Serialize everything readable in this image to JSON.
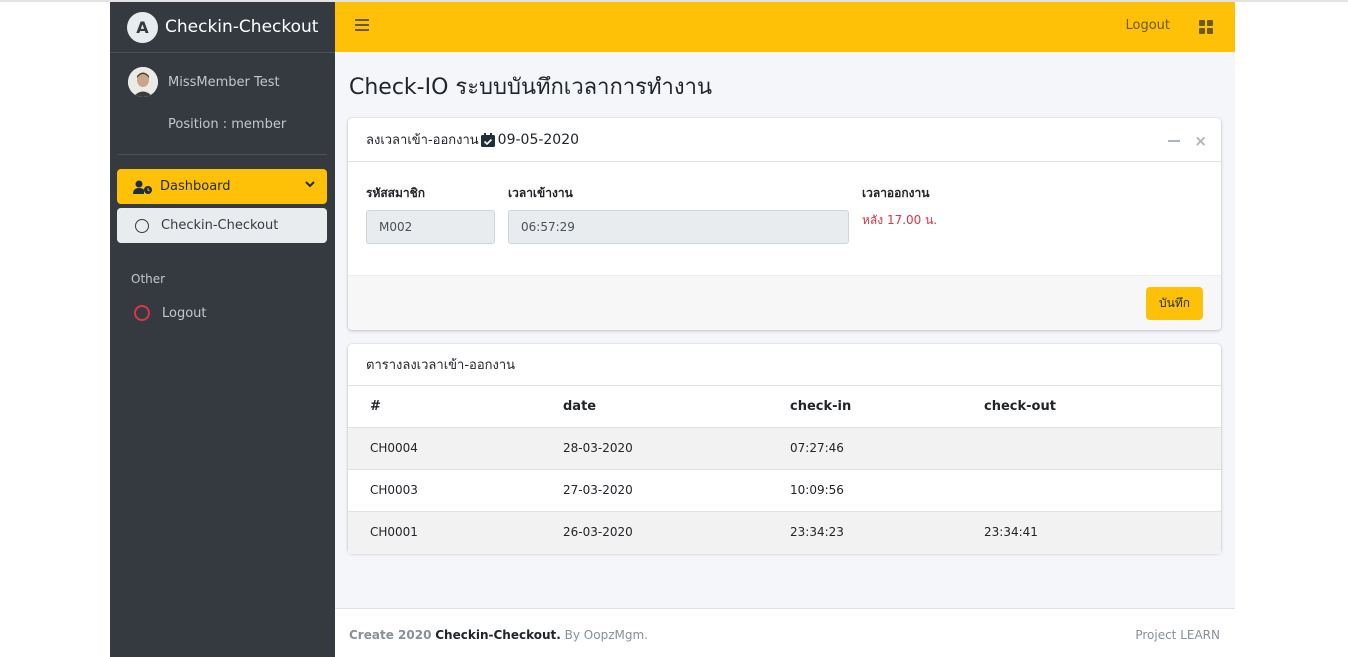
{
  "brand": {
    "name": "Checkin-Checkout",
    "logo_letter": "A"
  },
  "user": {
    "name": "MissMember Test",
    "position": "Position : member"
  },
  "sidebar": {
    "dashboard_label": "Dashboard",
    "submenu_label": "Checkin-Checkout",
    "other_header": "Other",
    "logout_label": "Logout"
  },
  "navbar": {
    "logout_label": "Logout"
  },
  "page": {
    "title": "Check-IO ระบบบันทึกเวลาการทำงาน"
  },
  "checkin_card": {
    "title": "ลงเวลาเข้า-ออกงาน",
    "date": "09-05-2020",
    "member_id_label": "รหัสสมาชิก",
    "member_id_value": "M002",
    "checkin_label": "เวลาเข้างาน",
    "checkin_value": "06:57:29",
    "checkout_label": "เวลาออกงาน",
    "checkout_note": "หลัง 17.00 น.",
    "save_label": "บันทึก"
  },
  "table_card": {
    "title": "ตารางลงเวลาเข้า-ออกงาน",
    "columns": [
      "#",
      "date",
      "check-in",
      "check-out"
    ],
    "rows": [
      {
        "id": "CH0004",
        "date": "28-03-2020",
        "checkin": "07:27:46",
        "checkout": ""
      },
      {
        "id": "CH0003",
        "date": "27-03-2020",
        "checkin": "10:09:56",
        "checkout": ""
      },
      {
        "id": "CH0001",
        "date": "26-03-2020",
        "checkin": "23:34:23",
        "checkout": "23:34:41"
      }
    ]
  },
  "footer": {
    "prefix": "Create 2020",
    "app": "Checkin-Checkout.",
    "suffix": "By OopzMgm.",
    "right": "Project LEARN"
  },
  "colors": {
    "accent": "#ffc107",
    "sidebar": "#343a40",
    "danger": "#dc3545"
  }
}
